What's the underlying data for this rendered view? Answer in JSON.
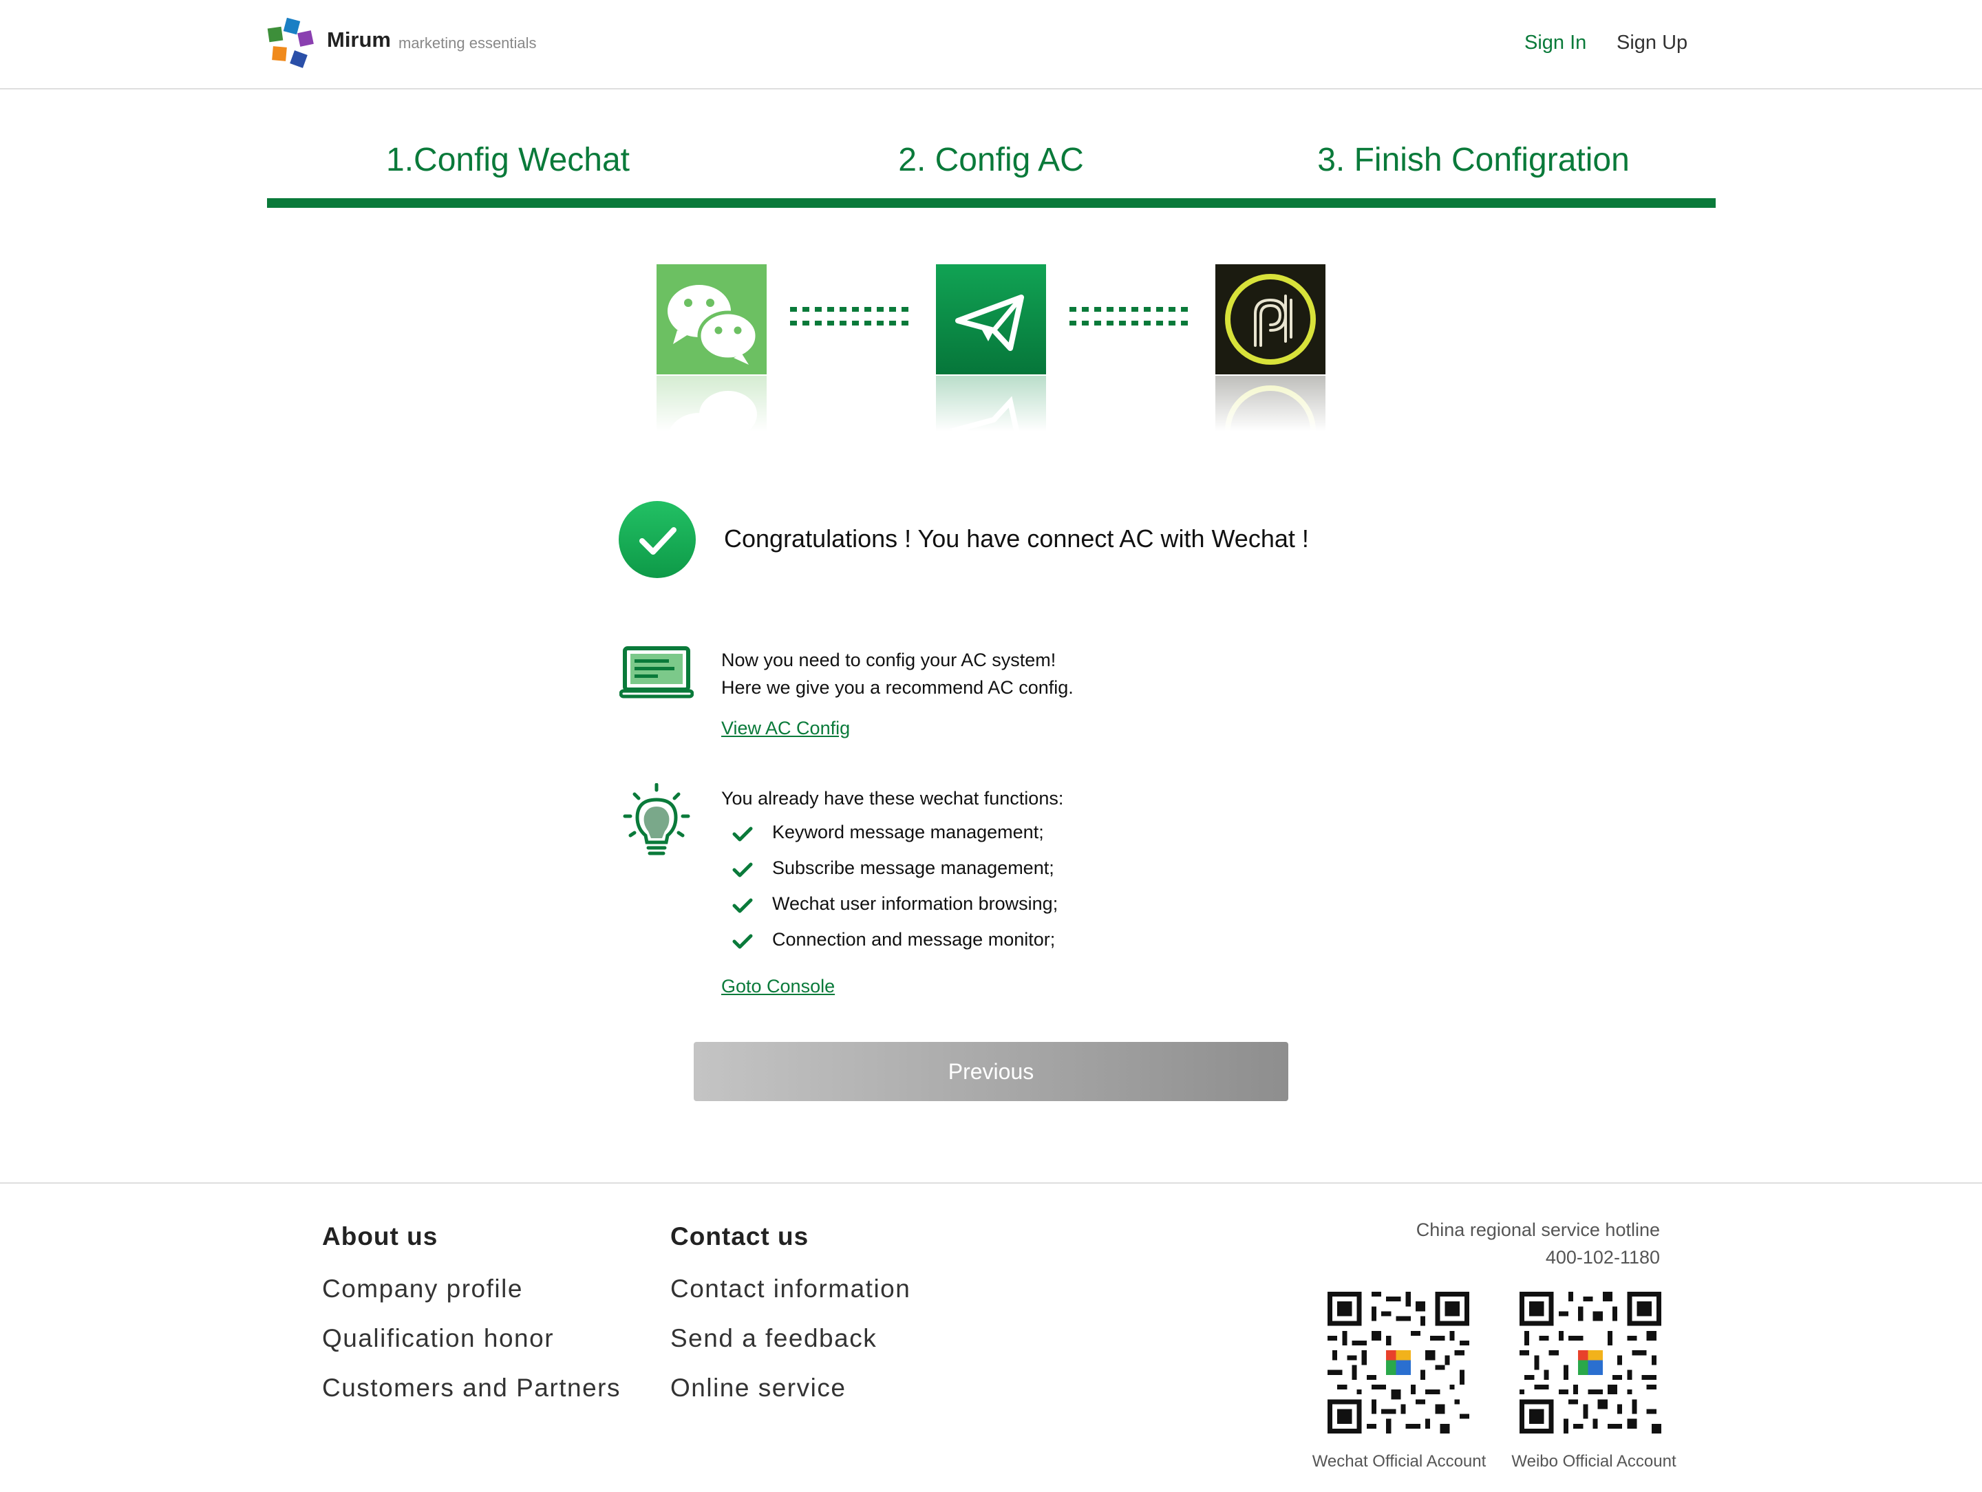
{
  "header": {
    "brand_name": "Mirum",
    "brand_tagline": "marketing essentials",
    "nav": {
      "sign_in": "Sign In",
      "sign_up": "Sign Up"
    }
  },
  "steps": [
    {
      "label": "1.Config Wechat"
    },
    {
      "label": "2. Config AC"
    },
    {
      "label": "3. Finish Configration"
    }
  ],
  "integration": {
    "icons": [
      "wechat-app-icon",
      "paper-plane-app-icon",
      "ac-logo-app-icon"
    ],
    "colors": {
      "wechat": "#6cc062",
      "plane": "#0a8a45",
      "ac_bg": "#1b1b10",
      "ac_ring": "#d8e23a"
    }
  },
  "result": {
    "message": "Congratulations ! You have connect AC with Wechat !"
  },
  "ac_config": {
    "line1": "Now you need to config your AC system!",
    "line2": "Here we give you a recommend AC config.",
    "link": "View AC Config"
  },
  "functions": {
    "intro": "You already have these wechat functions:",
    "items": [
      "Keyword message management;",
      "Subscribe message management;",
      "Wechat user information browsing;",
      "Connection and message monitor;"
    ],
    "link": "Goto Console"
  },
  "actions": {
    "previous": "Previous"
  },
  "footer": {
    "about": {
      "title": "About us",
      "links": [
        "Company profile",
        "Qualification honor",
        "Customers and Partners"
      ]
    },
    "contact": {
      "title": "Contact us",
      "links": [
        "Contact information",
        "Send a feedback",
        "Online service"
      ]
    },
    "hotline_label": "China regional service hotline",
    "hotline_number": "400-102-1180",
    "qr_codes": [
      {
        "caption": "Wechat Official Account"
      },
      {
        "caption": "Weibo Official Account"
      }
    ]
  },
  "colors": {
    "accent": "#0a7a3a",
    "success": "#1fb55a",
    "button_gradient_start": "#c4c4c4",
    "button_gradient_end": "#8e8e8e"
  }
}
